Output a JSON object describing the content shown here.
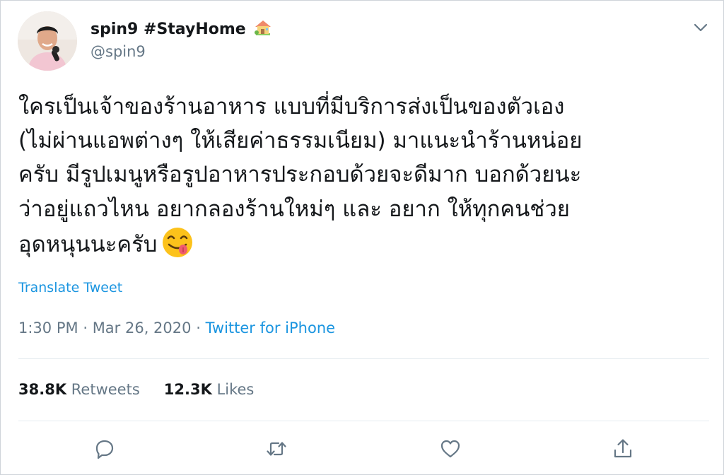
{
  "user": {
    "display_name": "spin9 #StayHome",
    "name_emoji": "house-with-garden-icon",
    "handle": "@spin9"
  },
  "tweet": {
    "lines": [
      "ใครเป็นเจ้าของร้านอาหาร แบบที่มีบริการส่งเป็นของตัวเอง",
      "(ไม่ผ่านแอพต่างๆ ให้เสียค่าธรรมเนียม) มาแนะนำร้านหน่อย",
      "ครับ มีรูปเมนูหรือรูปอาหารประกอบด้วยจะดีมาก บอกด้วยนะ",
      "ว่าอยู่แถวไหน อยากลองร้านใหม่ๆ และ อยาก ให้ทุกคนช่วย",
      "อุดหนุนนะครับ"
    ],
    "trailing_emoji": "face-savoring-food-icon",
    "translate_label": "Translate Tweet",
    "time": "1:30 PM",
    "date": "Mar 26, 2020",
    "separator": "·",
    "source": "Twitter for iPhone"
  },
  "stats": {
    "retweets_count": "38.8K",
    "retweets_label": "Retweets",
    "likes_count": "12.3K",
    "likes_label": "Likes"
  },
  "actions": [
    "reply-icon",
    "retweet-icon",
    "like-icon",
    "share-icon"
  ],
  "colors": {
    "link": "#1b95e0",
    "secondary_text": "#657786",
    "primary_text": "#14171a",
    "divider": "#e6ecf0",
    "action_icon": "#657786"
  }
}
